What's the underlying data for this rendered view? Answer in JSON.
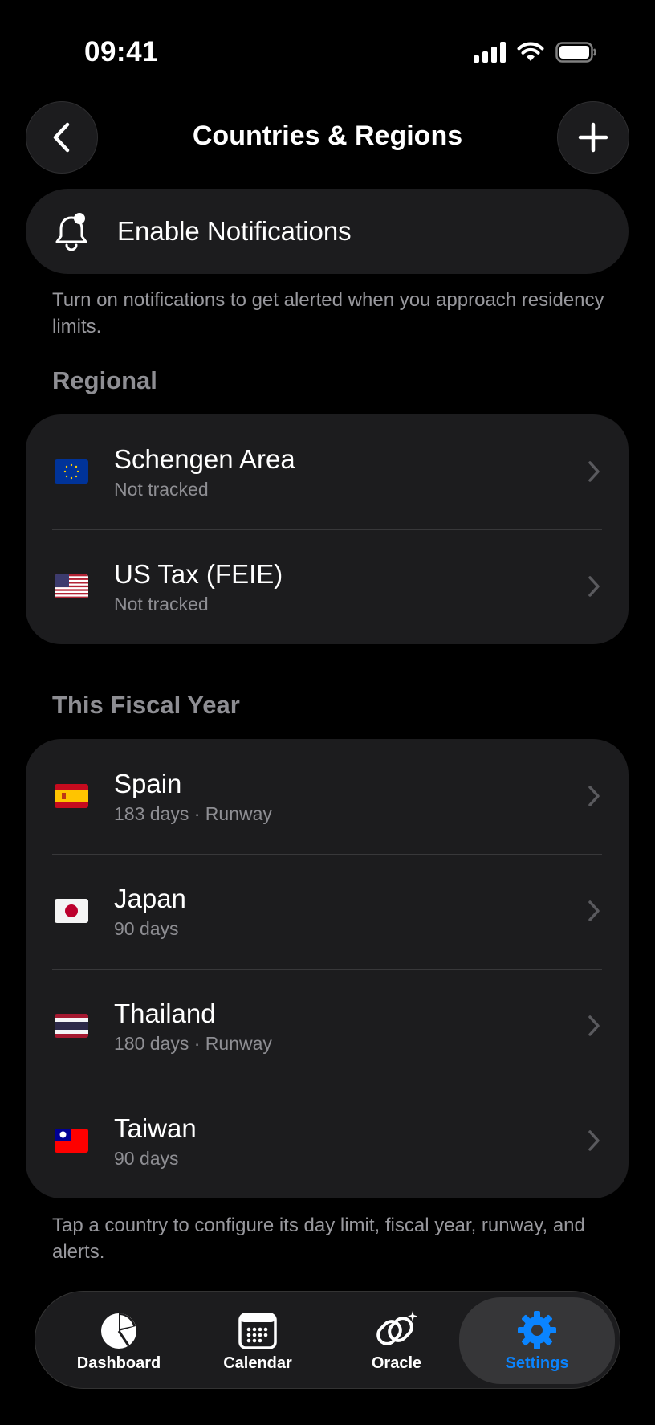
{
  "status_bar": {
    "time": "09:41"
  },
  "header": {
    "title": "Countries & Regions",
    "back_icon": "chevron-left-icon",
    "add_icon": "plus-icon"
  },
  "notifications": {
    "label": "Enable Notifications",
    "caption": "Turn on notifications to get alerted when you approach residency limits."
  },
  "regional": {
    "header": "Regional",
    "items": [
      {
        "title": "Schengen Area",
        "subtitle": "Not tracked",
        "flag": "eu-flag"
      },
      {
        "title": "US Tax (FEIE)",
        "subtitle": "Not tracked",
        "flag": "us-flag"
      }
    ]
  },
  "fiscal": {
    "header": "This Fiscal Year",
    "items": [
      {
        "title": "Spain",
        "subtitle": "183 days · Runway",
        "flag": "es-flag"
      },
      {
        "title": "Japan",
        "subtitle": "90 days",
        "flag": "jp-flag"
      },
      {
        "title": "Thailand",
        "subtitle": "180 days · Runway",
        "flag": "th-flag"
      },
      {
        "title": "Taiwan",
        "subtitle": "90 days",
        "flag": "tw-flag"
      }
    ]
  },
  "footer_caption": "Tap a country to configure its day limit, fiscal year, runway, and alerts.",
  "tabs": [
    {
      "label": "Dashboard",
      "icon": "pie-chart-icon"
    },
    {
      "label": "Calendar",
      "icon": "calendar-icon"
    },
    {
      "label": "Oracle",
      "icon": "sparkle-link-icon"
    },
    {
      "label": "Settings",
      "icon": "gear-icon",
      "active": true
    }
  ],
  "colors": {
    "accent": "#0a84ff",
    "background": "#000000",
    "card": "#1c1c1e",
    "secondary_text": "#8e8e93"
  }
}
